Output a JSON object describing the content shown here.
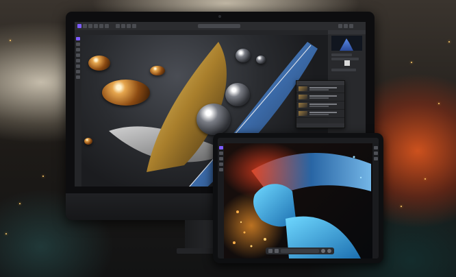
{
  "scene": {
    "description_label": "",
    "devices": [
      "imac",
      "ipad"
    ]
  },
  "imac_app": {
    "toolbar": {
      "accent_color": "#7d5cff",
      "buttons_left": [
        "app-menu-icon",
        "persona-photo-icon",
        "persona-liquify-icon",
        "persona-develop-icon",
        "persona-tone-map-icon",
        "persona-export-icon"
      ],
      "buttons_center": [
        "view-mode-icon",
        "zoom-icon"
      ],
      "buttons_right": [
        "assistant-icon",
        "snapping-icon",
        "share-icon"
      ]
    },
    "tools": [
      "move-tool-icon",
      "selection-tool-icon",
      "brush-tool-icon",
      "crop-tool-icon",
      "clone-tool-icon",
      "healing-tool-icon",
      "text-tool-icon",
      "shape-tool-icon"
    ],
    "panels": {
      "histogram_color": "#5b8be8"
    }
  },
  "ipad_app": {
    "accent_color": "#7d5cff",
    "bottom_bar": [
      "undo-icon",
      "redo-icon",
      "layers-icon",
      "settings-icon"
    ]
  }
}
